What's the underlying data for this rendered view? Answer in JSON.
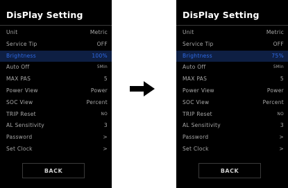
{
  "screens": [
    {
      "title": "DisPlay Setting",
      "items": [
        {
          "label": "Unit",
          "value": "Metric"
        },
        {
          "label": "Service Tip",
          "value": "OFF"
        },
        {
          "label": "Brightness",
          "value": "100%",
          "selected": true
        },
        {
          "label": "Auto Off",
          "value": "5Min"
        },
        {
          "label": "MAX PAS",
          "value": "5"
        },
        {
          "label": "Power View",
          "value": "Power"
        },
        {
          "label": "SOC View",
          "value": "Percent"
        },
        {
          "label": "TRIP Reset",
          "value": "NO"
        },
        {
          "label": "AL Sensitivity",
          "value": "3"
        },
        {
          "label": "Password",
          "value": ">"
        },
        {
          "label": "Set Clock",
          "value": ">"
        }
      ],
      "back_label": "BACK"
    },
    {
      "title": "DisPlay Setting",
      "items": [
        {
          "label": "Unit",
          "value": "Metric"
        },
        {
          "label": "Service Tip",
          "value": "OFF"
        },
        {
          "label": "Brightness",
          "value": "75%",
          "selected": true
        },
        {
          "label": "Auto Off",
          "value": "5Min"
        },
        {
          "label": "MAX PAS",
          "value": "5"
        },
        {
          "label": "Power View",
          "value": "Power"
        },
        {
          "label": "SOC View",
          "value": "Percent"
        },
        {
          "label": "TRIP Reset",
          "value": "NO"
        },
        {
          "label": "AL Sensitivity",
          "value": "3"
        },
        {
          "label": "Password",
          "value": ">"
        },
        {
          "label": "Set Clock",
          "value": ">"
        }
      ],
      "back_label": "BACK"
    }
  ],
  "transition_icon": "right-arrow-icon",
  "colors": {
    "screen_background": "#000000",
    "highlight_background": "#0e1f43",
    "highlight_text": "#2f6be8",
    "text": "#a9a9a9"
  }
}
